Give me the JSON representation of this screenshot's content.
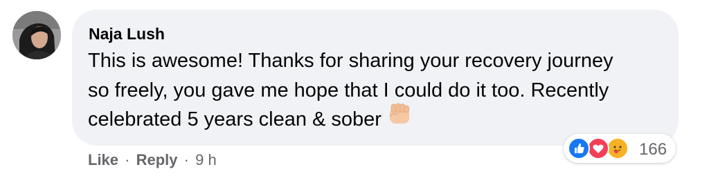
{
  "comment": {
    "author": "Naja Lush",
    "text_lines": [
      "This is awesome! Thanks for sharing your recovery journey",
      "so freely, you gave me hope that I could do it too. Recently",
      "celebrated 5 years clean & sober"
    ],
    "emoji": "raised-fist-emoji"
  },
  "reactions": {
    "types": [
      "like-icon",
      "love-icon",
      "care-icon"
    ],
    "count": "166"
  },
  "actions": {
    "like_label": "Like",
    "separator": "·",
    "reply_label": "Reply",
    "timestamp": "9 h"
  },
  "colors": {
    "bubble_bg": "#f0f2f5",
    "secondary_text": "#65676b",
    "like_blue": "#1877f2",
    "love_red": "#f33e58",
    "care_yellow": "#f7b125"
  }
}
